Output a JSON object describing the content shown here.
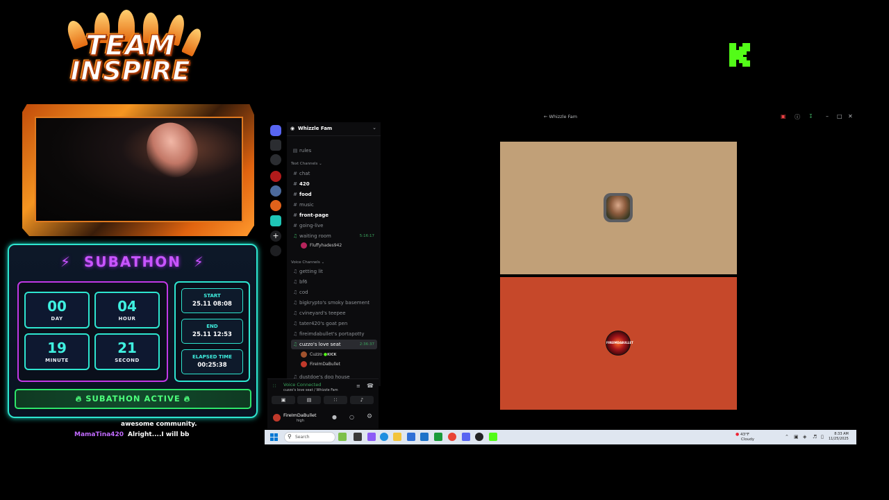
{
  "logo": {
    "line1": "TEAM",
    "line2": "INSPIRE"
  },
  "kick_logo": {
    "letter": "K",
    "color": "#53fc18"
  },
  "subathon": {
    "title": "SUBATHON",
    "day": {
      "value": "00",
      "label": "DAY"
    },
    "hour": {
      "value": "04",
      "label": "HOUR"
    },
    "minute": {
      "value": "19",
      "label": "MINUTE"
    },
    "second": {
      "value": "21",
      "label": "SECOND"
    },
    "start": {
      "label": "START",
      "value": "25.11 08:08"
    },
    "end": {
      "label": "END",
      "value": "25.11 12:53"
    },
    "elapsed": {
      "label": "ELAPSED TIME",
      "value": "00:25:38"
    },
    "active_label": "SUBATHON ACTIVE",
    "colors": {
      "accent": "#c955ff",
      "teal": "#2ee6d0",
      "green": "#4dff7c"
    }
  },
  "chat": [
    {
      "user": "",
      "text": "awesome community."
    },
    {
      "user": "MamaTina420",
      "text": "Alright....I will bb"
    }
  ],
  "discord": {
    "window_title": "Whizzle Fam",
    "server_name": "Whizzle Fam",
    "rules": "rules",
    "text_section": "Text Channels",
    "text_channels": [
      {
        "name": "chat",
        "bold": false
      },
      {
        "name": "420",
        "bold": true
      },
      {
        "name": "food",
        "bold": true
      },
      {
        "name": "music",
        "bold": false
      },
      {
        "name": "front-page",
        "bold": true
      },
      {
        "name": "going-live",
        "bold": false
      }
    ],
    "waiting_room": {
      "name": "waiting room",
      "timer": "5:16:17",
      "user": "Fluffyhades942"
    },
    "voice_section": "Voice Channels",
    "voice_channels": [
      "getting lit",
      "bf6",
      "cod",
      "bigkrypto's smoky basement",
      "cvineyard's teepee",
      "tater420's goat pen",
      "fireimdabullet's portapotty"
    ],
    "active_voice": {
      "name": "cuzzo's love seat",
      "timer": "2:36:37"
    },
    "active_users": [
      {
        "name": "Cuzzo",
        "tag": "KICK"
      },
      {
        "name": "FireImDaBullet",
        "tag": ""
      }
    ],
    "next_channel": "dustdoe's dog house",
    "voice_status": {
      "title": "Voice Connected",
      "subtitle": "cuzzo's love seat / Whizzle Fam"
    },
    "user_panel": {
      "name": "FireImDaBullet",
      "status": "high"
    },
    "tile_b_avatar_text": "FIREIMDABULLET",
    "colors": {
      "tile_a": "#c1a078",
      "tile_b": "#c6482a",
      "connected": "#3ba55d"
    }
  },
  "taskbar": {
    "search_placeholder": "Search",
    "weather_temp": "43°F",
    "weather_desc": "Cloudy",
    "time": "8:33 AM",
    "date": "11/25/2025"
  }
}
